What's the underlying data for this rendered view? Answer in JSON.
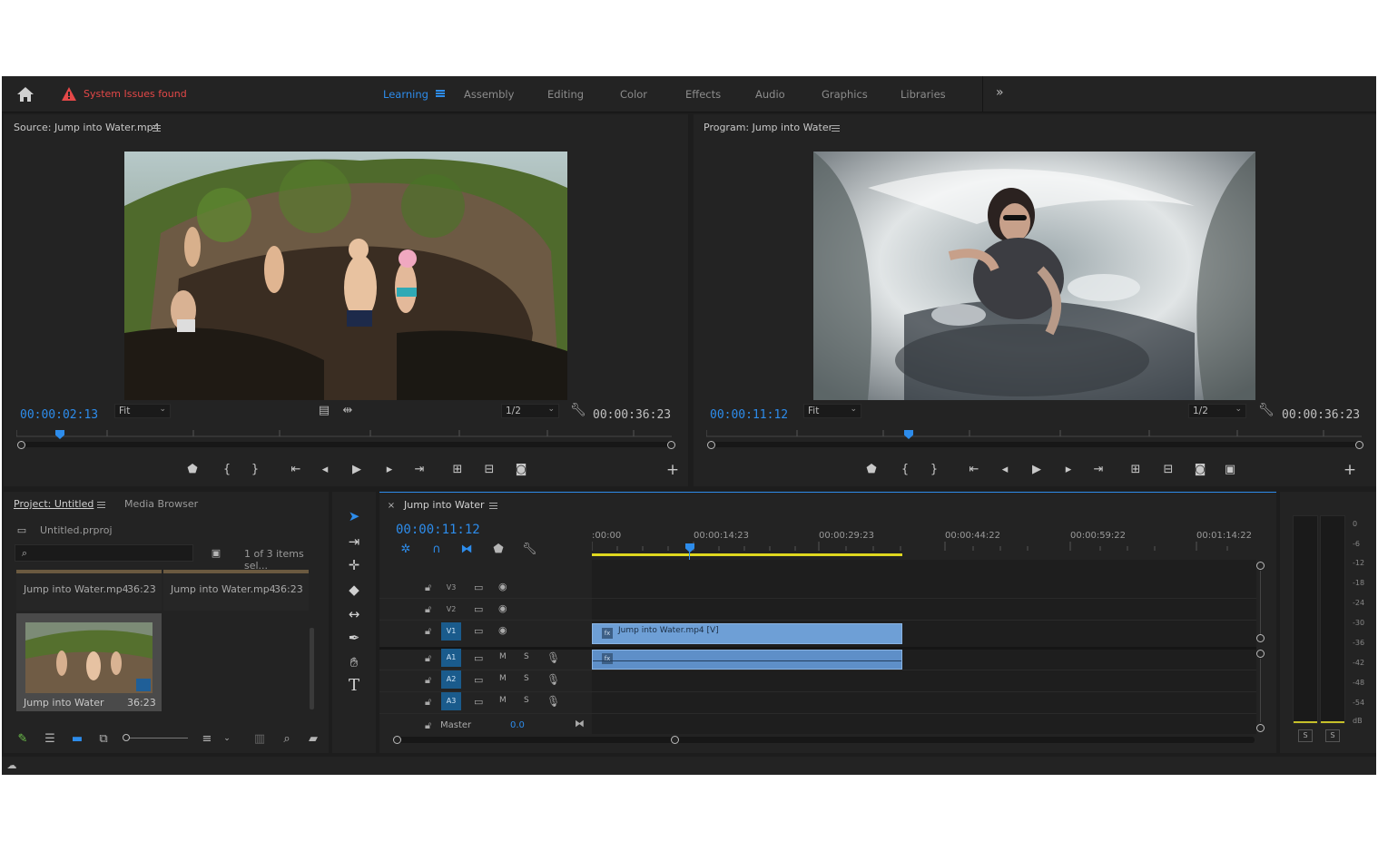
{
  "topbar": {
    "system_issues": "System Issues found",
    "workspaces": [
      "Learning",
      "Assembly",
      "Editing",
      "Color",
      "Effects",
      "Audio",
      "Graphics",
      "Libraries"
    ],
    "active_workspace": "Learning",
    "accent": "#2d8ceb",
    "warning_color": "#e44848"
  },
  "source_monitor": {
    "title": "Source: Jump into Water.mp4",
    "timecode": "00:00:02:13",
    "zoom": "Fit",
    "resolution": "1/2",
    "duration": "00:00:36:23",
    "playhead_fraction": 0.06
  },
  "program_monitor": {
    "title": "Program: Jump into Water",
    "timecode": "00:00:11:12",
    "zoom": "Fit",
    "resolution": "1/2",
    "duration": "00:00:36:23",
    "playhead_fraction": 0.3
  },
  "project": {
    "tab_project": "Project: Untitled",
    "tab_media": "Media Browser",
    "filename": "Untitled.prproj",
    "selection": "1 of 3 items sel...",
    "items": [
      {
        "name": "Jump into Water.mp4",
        "duration": "36:23"
      },
      {
        "name": "Jump into Water.mp4",
        "duration": "36:23"
      },
      {
        "name": "Jump into Water",
        "duration": "36:23"
      }
    ]
  },
  "timeline": {
    "tab": "Jump into Water",
    "timecode": "00:00:11:12",
    "ruler": [
      ":00:00",
      "00:00:14:23",
      "00:00:29:23",
      "00:00:44:22",
      "00:00:59:22",
      "00:01:14:22"
    ],
    "video_tracks": [
      "V3",
      "V2",
      "V1"
    ],
    "audio_tracks": [
      "A1",
      "A2",
      "A3"
    ],
    "master_label": "Master",
    "master_value": "0.0",
    "clip_label": "Jump into Water.mp4 [V]",
    "mute_label": "M",
    "solo_label": "S"
  },
  "audio_meter": {
    "scale": [
      "0",
      "-6",
      "-12",
      "-18",
      "-24",
      "-30",
      "-36",
      "-42",
      "-48",
      "-54",
      "dB"
    ],
    "solo": [
      "S",
      "S"
    ]
  }
}
